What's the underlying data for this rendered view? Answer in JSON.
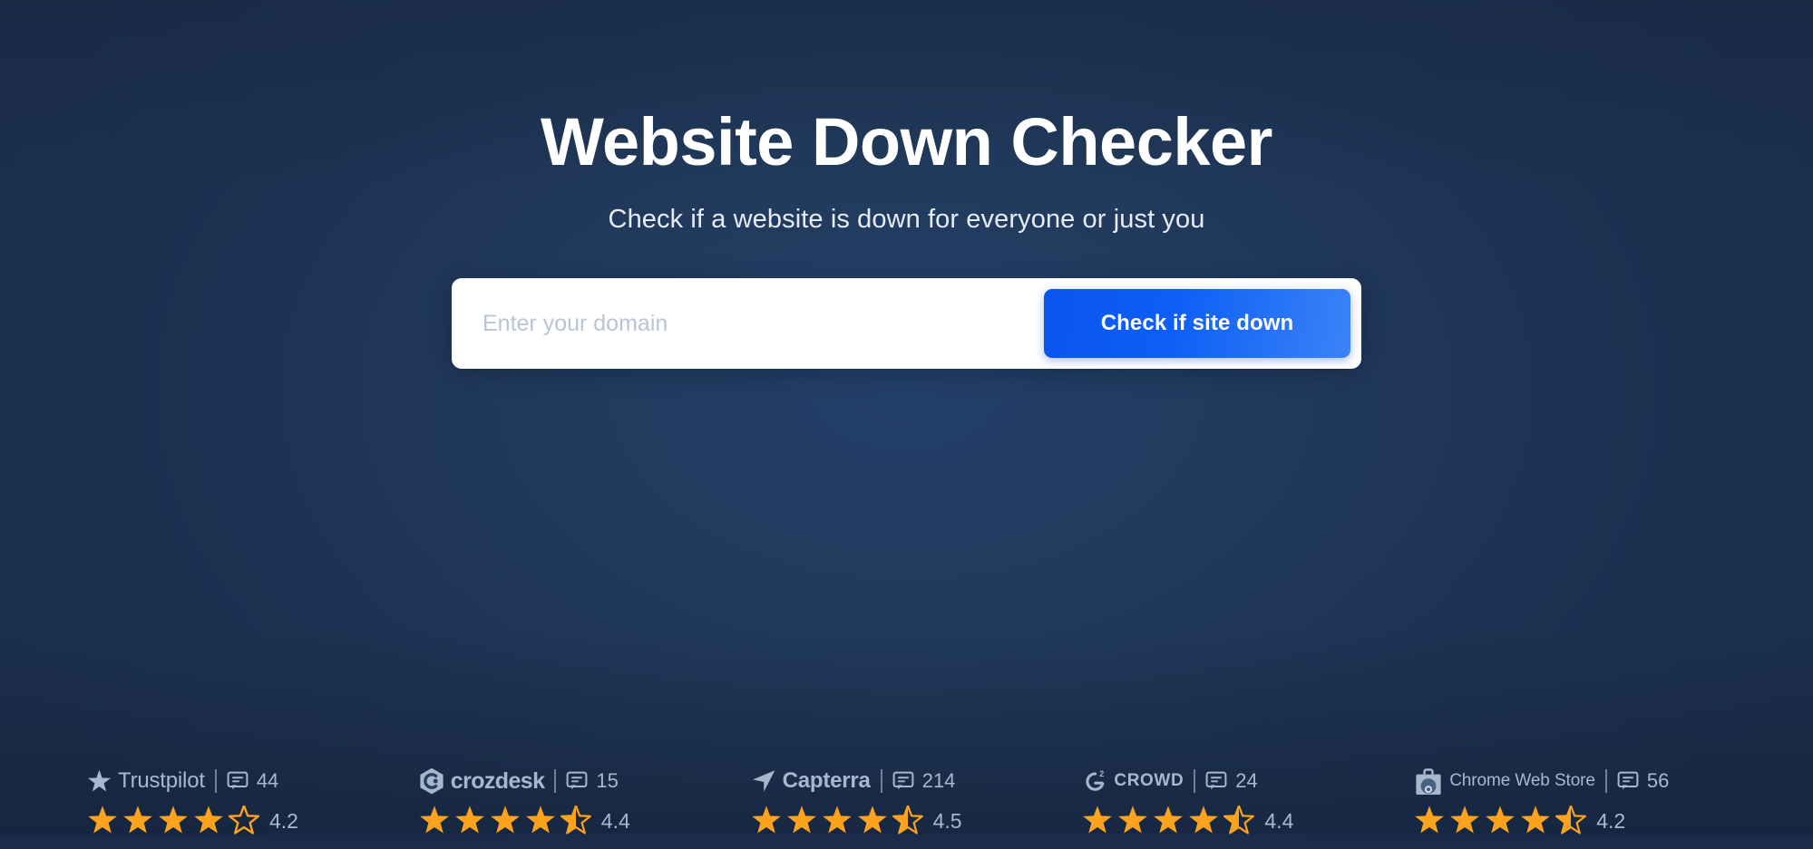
{
  "hero": {
    "title": "Website Down Checker",
    "subtitle": "Check if a website is down for everyone or just you"
  },
  "search": {
    "input_value": "",
    "placeholder": "Enter your domain",
    "button_label": "Check if site down"
  },
  "colors": {
    "background_dark": "#1b2e4d",
    "background_light": "#23406a",
    "button_gradient_start": "#0a54f0",
    "button_gradient_end": "#3b83f6",
    "star_filled": "#fba31e",
    "star_empty_stroke": "#fba31e",
    "muted_text": "#a8b8cc",
    "card_background": "#ffffff"
  },
  "badges": [
    {
      "brand": "Trustpilot",
      "logo_icon": "trustpilot-star-icon",
      "review_icon": "speech-bubble-icon",
      "review_count": "44",
      "rating": "4.2",
      "stars_filled": 4,
      "stars_half": 0,
      "stars_empty": 1
    },
    {
      "brand": "crozdesk",
      "logo_icon": "crozdesk-hexagon-icon",
      "review_icon": "speech-bubble-icon",
      "review_count": "15",
      "rating": "4.4",
      "stars_filled": 4,
      "stars_half": 1,
      "stars_empty": 0
    },
    {
      "brand": "Capterra",
      "logo_icon": "capterra-arrow-icon",
      "review_icon": "speech-bubble-icon",
      "review_count": "214",
      "rating": "4.5",
      "stars_filled": 4,
      "stars_half": 1,
      "stars_empty": 0
    },
    {
      "brand": "CROWD",
      "logo_icon": "g2-crowd-icon",
      "review_icon": "speech-bubble-icon",
      "review_count": "24",
      "rating": "4.4",
      "stars_filled": 4,
      "stars_half": 1,
      "stars_empty": 0
    },
    {
      "brand": "Chrome Web Store",
      "logo_icon": "chrome-web-store-bag-icon",
      "review_icon": "speech-bubble-icon",
      "review_count": "56",
      "rating": "4.2",
      "stars_filled": 4,
      "stars_half": 1,
      "stars_empty": 0
    }
  ]
}
